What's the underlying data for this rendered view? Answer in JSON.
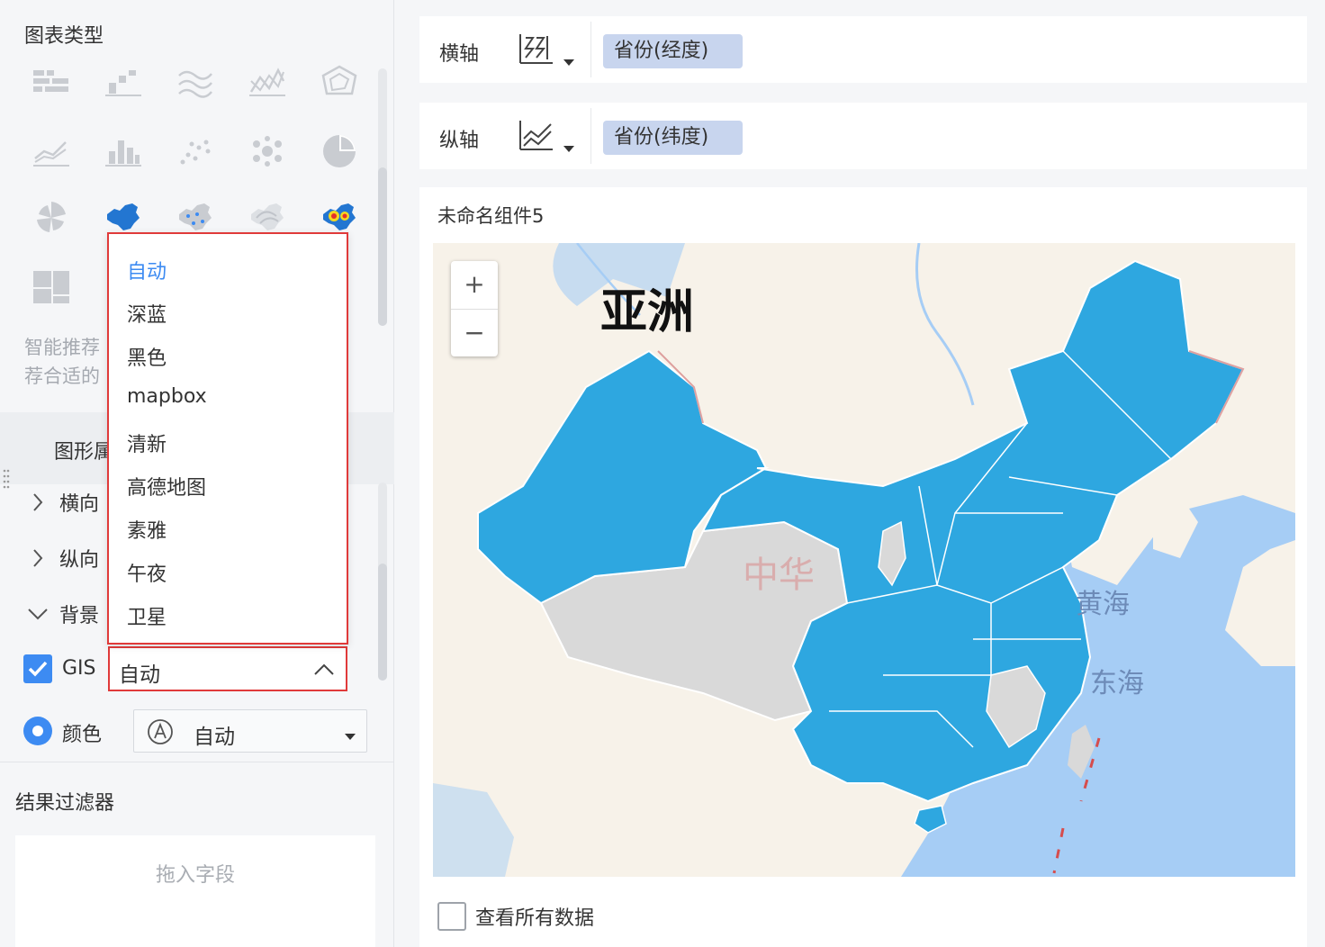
{
  "left": {
    "chart_type_title": "图表类型",
    "chart_types": [
      "multi-column-bar-icon",
      "grouped-bar-icon",
      "area-wave-icon",
      "polyline-icon",
      "radar-icon",
      "line-chart-icon",
      "column-chart-icon",
      "scatter-icon",
      "bubble-icon",
      "pie-icon",
      "rose-pie-icon",
      "china-region-map-icon",
      "china-point-map-icon",
      "china-flow-map-icon",
      "china-heat-map-icon",
      "treemap-icon"
    ],
    "hint_line1": "智能推荐",
    "hint_line2": "荐合适的",
    "tab_label": "图形属",
    "rows": {
      "horizontal": "横向",
      "vertical": "纵向",
      "background": "背景"
    },
    "gis": {
      "label": "GIS",
      "value": "自动",
      "checked": true
    },
    "color": {
      "label": "颜色",
      "value": "自动"
    },
    "filter_title": "结果过滤器",
    "dropzone_text": "拖入字段"
  },
  "dropdown": {
    "options": [
      "自动",
      "深蓝",
      "黑色",
      "mapbox",
      "清新",
      "高德地图",
      "素雅",
      "午夜",
      "卫星"
    ],
    "selected_index": 0
  },
  "axes": {
    "x": {
      "label": "横轴",
      "field": "省份(经度)"
    },
    "y": {
      "label": "纵轴",
      "field": "省份(纬度)"
    }
  },
  "chart": {
    "title": "未命名组件5",
    "zoom_in": "+",
    "zoom_out": "−",
    "labels": {
      "asia": "亚洲",
      "china": "中华",
      "yellow_sea": "黄海",
      "east_sea": "东海"
    },
    "view_all": "查看所有数据"
  },
  "colors": {
    "accent": "#3d8bf2",
    "highlight_border": "#e03a3a",
    "region_fill": "#2ea7e0",
    "region_empty": "#d9d9d9",
    "water": "#a6cdf5",
    "land": "#f7f2e9"
  }
}
